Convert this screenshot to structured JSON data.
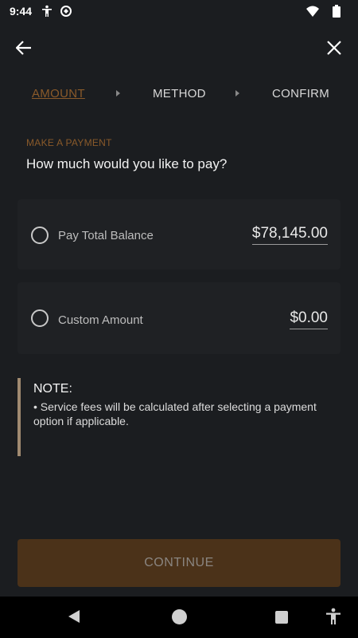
{
  "status_bar": {
    "time": "9:44",
    "icons": [
      "accessibility-icon",
      "sync-icon",
      "wifi-icon",
      "battery-icon"
    ]
  },
  "top_bar": {
    "back_icon": "arrow-left-icon",
    "close_icon": "close-icon"
  },
  "stepper": {
    "steps": [
      {
        "label": "AMOUNT",
        "active": true
      },
      {
        "label": "METHOD",
        "active": false
      },
      {
        "label": "CONFIRM",
        "active": false
      }
    ]
  },
  "heading": {
    "eyebrow": "MAKE A PAYMENT",
    "question": "How much would you like to pay?"
  },
  "options": [
    {
      "label": "Pay Total Balance",
      "amount": "$78,145.00",
      "selected": false
    },
    {
      "label": "Custom Amount",
      "amount": "$0.00",
      "selected": false
    }
  ],
  "note": {
    "title": "NOTE:",
    "body": "• Service fees will be calculated after selecting a payment option if applicable."
  },
  "continue_label": "CONTINUE",
  "colors": {
    "accent": "#8a5a2a",
    "button_bg": "#4b3219",
    "background": "#1b1d20",
    "card_bg": "#1f2124"
  }
}
